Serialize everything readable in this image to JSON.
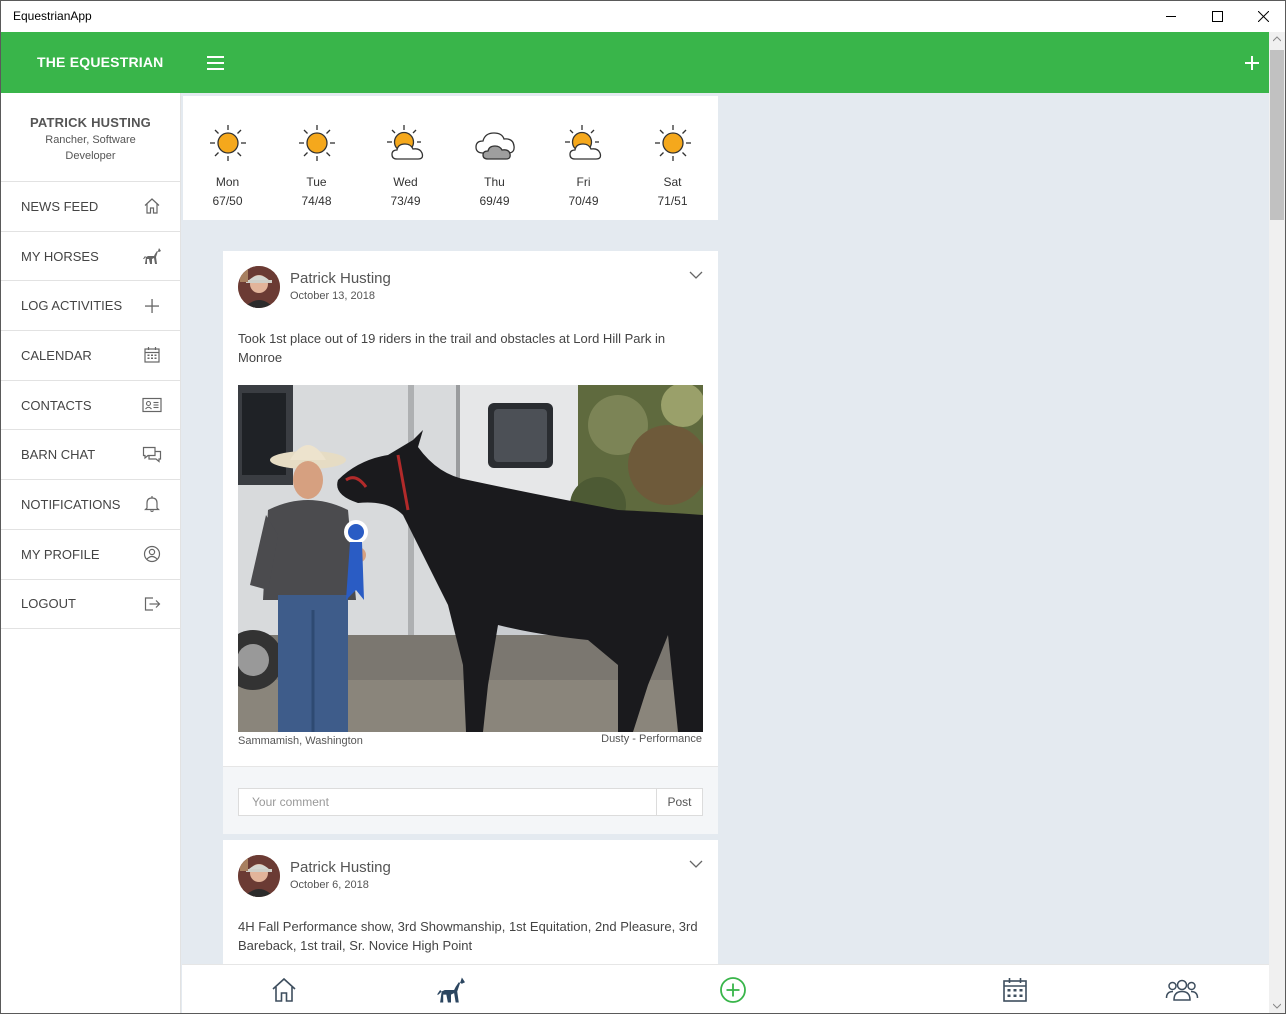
{
  "window": {
    "title": "EquestrianApp",
    "controls": [
      "minimize-icon",
      "maximize-icon",
      "close-icon"
    ]
  },
  "header": {
    "brand": "THE EQUESTRIAN",
    "menu_icon": "hamburger-icon",
    "add_icon": "plus-icon",
    "color": "#39b54a"
  },
  "profile": {
    "name": "PATRICK HUSTING",
    "role": "Rancher, Software Developer"
  },
  "sidebar": {
    "items": [
      {
        "label": "NEWS FEED",
        "icon": "home-icon"
      },
      {
        "label": "MY HORSES",
        "icon": "horse-icon"
      },
      {
        "label": "LOG ACTIVITIES",
        "icon": "plus-icon"
      },
      {
        "label": "CALENDAR",
        "icon": "calendar-icon"
      },
      {
        "label": "CONTACTS",
        "icon": "contact-card-icon"
      },
      {
        "label": "BARN CHAT",
        "icon": "chat-icon"
      },
      {
        "label": "NOTIFICATIONS",
        "icon": "bell-icon"
      },
      {
        "label": "MY PROFILE",
        "icon": "user-circle-icon"
      },
      {
        "label": "LOGOUT",
        "icon": "logout-icon"
      }
    ]
  },
  "weather": {
    "days": [
      {
        "name": "Mon",
        "temp": "67/50",
        "icon": "sunny-icon"
      },
      {
        "name": "Tue",
        "temp": "74/48",
        "icon": "sunny-icon"
      },
      {
        "name": "Wed",
        "temp": "73/49",
        "icon": "partly-cloudy-icon"
      },
      {
        "name": "Thu",
        "temp": "69/49",
        "icon": "cloudy-icon"
      },
      {
        "name": "Fri",
        "temp": "70/49",
        "icon": "partly-cloudy-icon"
      },
      {
        "name": "Sat",
        "temp": "71/51",
        "icon": "sunny-icon"
      }
    ]
  },
  "posts": [
    {
      "author": "Patrick Husting",
      "date": "October 13, 2018",
      "text": "Took 1st place out of 19 riders in the trail and obstacles at Lord Hill Park in Monroe",
      "location": "Sammamish, Washington",
      "horse": "Dusty - Performance",
      "comment_placeholder": "Your comment",
      "post_label": "Post"
    },
    {
      "author": "Patrick Husting",
      "date": "October 6, 2018",
      "text": "4H Fall Performance show, 3rd Showmanship, 1st Equitation, 2nd Pleasure, 3rd Bareback, 1st trail, Sr. Novice High Point"
    }
  ],
  "bottom_nav": [
    "home-icon",
    "horse-icon",
    "add-circle-icon",
    "calendar-icon",
    "group-icon"
  ]
}
